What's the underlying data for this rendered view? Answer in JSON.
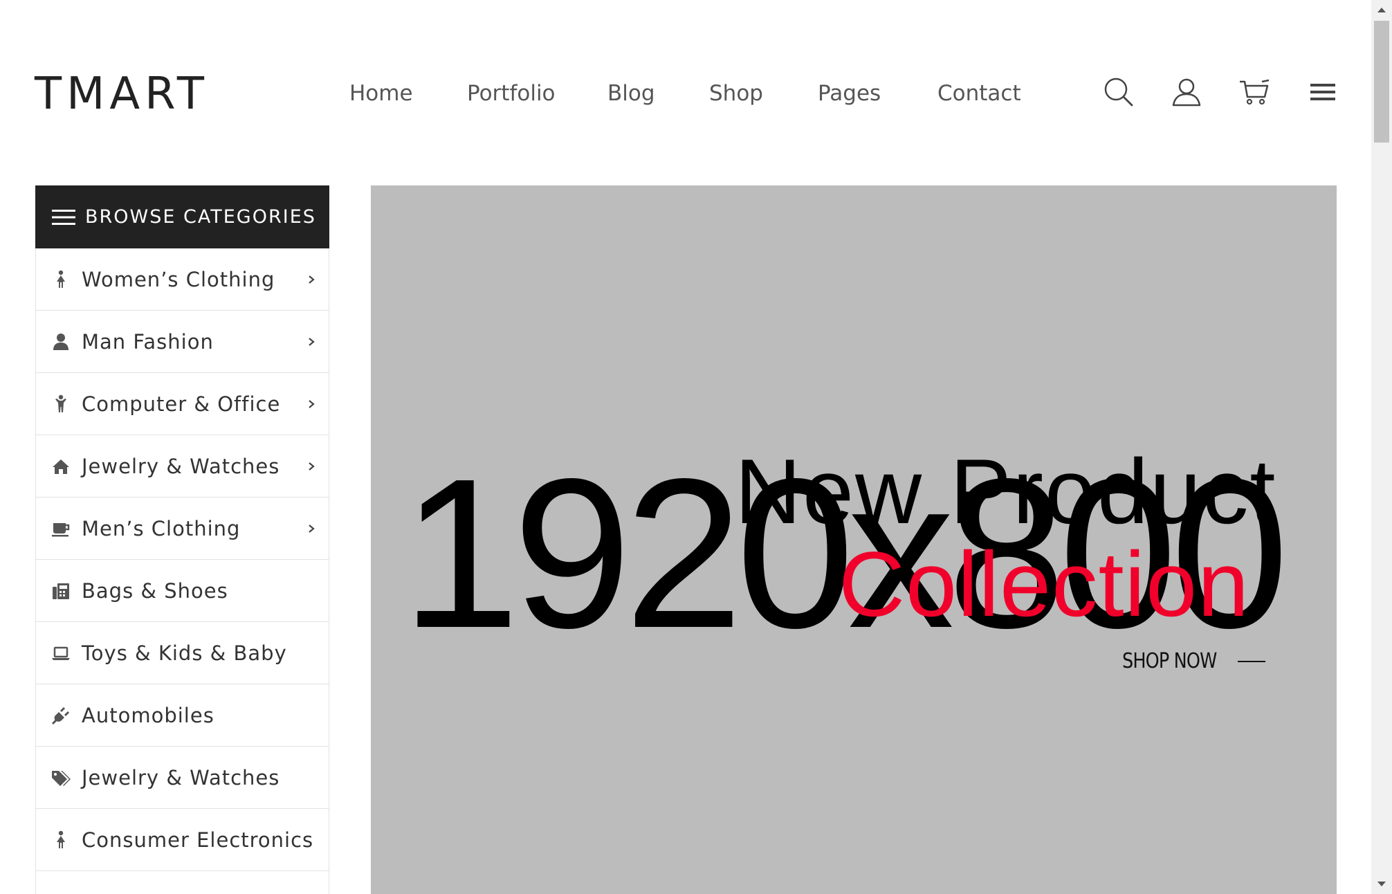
{
  "header": {
    "logo": "TMART",
    "nav": [
      "Home",
      "Portfolio",
      "Blog",
      "Shop",
      "Pages",
      "Contact"
    ],
    "icons": [
      "search-icon",
      "user-icon",
      "cart-icon",
      "hamburger-menu-icon"
    ]
  },
  "categories": {
    "title": "BROWSE CATEGORIES",
    "items": [
      {
        "label": "Women’s Clothing",
        "icon": "female-icon",
        "has_submenu": true
      },
      {
        "label": "Man Fashion",
        "icon": "user-icon",
        "has_submenu": true
      },
      {
        "label": "Computer & Office",
        "icon": "child-icon",
        "has_submenu": true
      },
      {
        "label": "Jewelry & Watches",
        "icon": "home-icon",
        "has_submenu": true
      },
      {
        "label": "Men’s Clothing",
        "icon": "coffee-cup-icon",
        "has_submenu": true
      },
      {
        "label": "Bags & Shoes",
        "icon": "fax-icon",
        "has_submenu": false
      },
      {
        "label": "Toys & Kids & Baby",
        "icon": "laptop-icon",
        "has_submenu": false
      },
      {
        "label": "Automobiles",
        "icon": "plug-icon",
        "has_submenu": false
      },
      {
        "label": "Jewelry & Watches",
        "icon": "tags-icon",
        "has_submenu": false
      },
      {
        "label": "Consumer Electronics",
        "icon": "female-icon",
        "has_submenu": false
      }
    ]
  },
  "banner": {
    "placeholder": "1920x800",
    "title_line1": "New Product",
    "title_line2": "Collection",
    "cta": "SHOP NOW",
    "colors": {
      "background": "#bcbcbc",
      "accent": "#f0002a"
    }
  }
}
